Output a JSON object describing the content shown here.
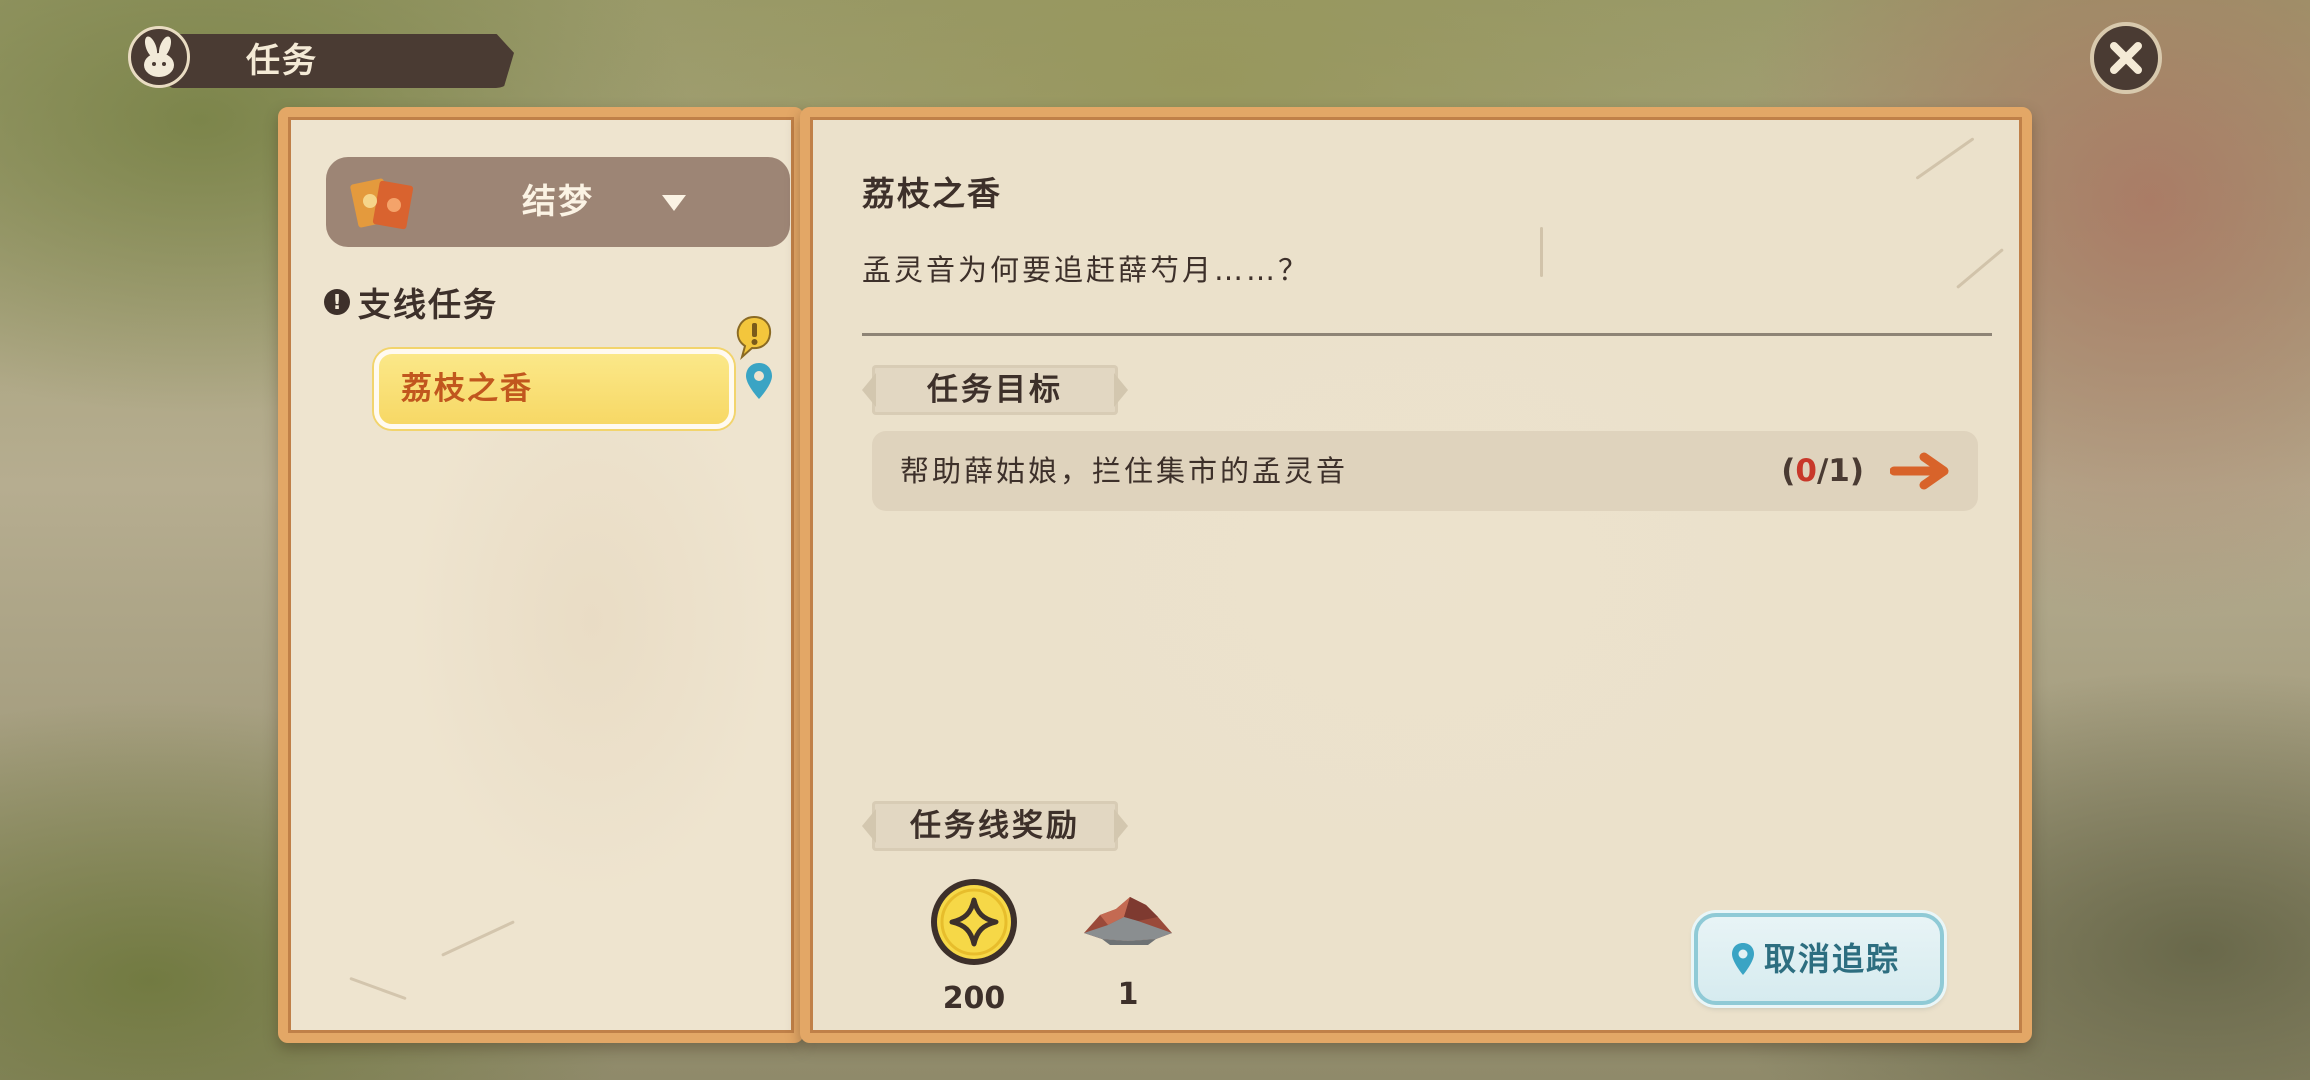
{
  "header": {
    "title": "任务",
    "icon": "rabbit-icon",
    "close_icon": "close-icon"
  },
  "sidebar": {
    "category": {
      "label": "结梦",
      "icon": "book-icon",
      "chevron": "chevron-down-icon"
    },
    "section": {
      "label": "支线任务",
      "icon": "alert-icon"
    },
    "quests": [
      {
        "label": "荔枝之香",
        "selected": true,
        "badge_icon": "exclamation-bubble-icon",
        "tracked_icon": "map-pin-icon"
      }
    ]
  },
  "detail": {
    "title": "荔枝之香",
    "description": "孟灵音为何要追赶薛芍月……？",
    "objectives_heading": "任务目标",
    "objectives": [
      {
        "text": "帮助薛姑娘，拦住集市的孟灵音",
        "progress_open": "(",
        "progress_current": "0",
        "progress_total": "/1)",
        "arrow_icon": "arrow-right-icon"
      }
    ],
    "rewards_heading": "任务线奖励",
    "rewards": [
      {
        "icon": "coin-icon",
        "count": "200"
      },
      {
        "icon": "ore-icon",
        "count": "1"
      }
    ],
    "untrack_button": {
      "label": "取消追踪",
      "icon": "map-pin-icon"
    }
  },
  "colors": {
    "panel_border": "#e3a766",
    "dark_text": "#3d302a",
    "selected_quest_text": "#c1571e",
    "progress_current": "#c8382a",
    "untrack_text": "#2d6e80"
  }
}
